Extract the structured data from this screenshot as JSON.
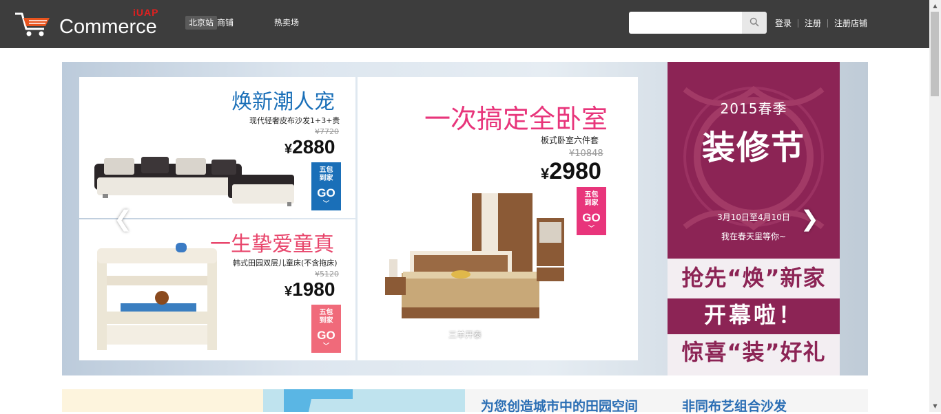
{
  "header": {
    "logo_badge": "iUAP",
    "logo_text": "Commerce",
    "city": "北京站",
    "nav": [
      "商铺",
      "热卖场"
    ],
    "search": {
      "placeholder": "",
      "value": ""
    },
    "links": [
      "登录",
      "注册",
      "注册店铺"
    ],
    "colors": {
      "bar": "#3d3d3d",
      "badge": "#e02020"
    }
  },
  "banner": {
    "prev_icon": "chevron-left-icon",
    "next_icon": "chevron-right-icon",
    "caption": "三羊开泰",
    "ads": [
      {
        "title": "焕新潮人宠",
        "subtitle": "现代轻奢皮布沙发1+3+贵",
        "old_price": "¥7720",
        "currency": "¥",
        "price": "2880",
        "tag_line1": "五包",
        "tag_line2": "到家",
        "tag_go": "GO",
        "title_color": "#1a6fb8",
        "tag_color": "#1a6fb8"
      },
      {
        "title": "一生挚爱童真",
        "subtitle": "韩式田园双层儿童床(不含拖床)",
        "old_price": "¥5120",
        "currency": "¥",
        "price": "1980",
        "tag_line1": "五包",
        "tag_line2": "到家",
        "tag_go": "GO",
        "title_color": "#e8456b",
        "tag_color": "#f06a7a"
      },
      {
        "title": "一次搞定全卧室",
        "subtitle": "板式卧室六件套",
        "old_price": "¥10848",
        "currency": "¥",
        "price": "2980",
        "tag_line1": "五包",
        "tag_line2": "到家",
        "tag_go": "GO",
        "title_color": "#e8357b",
        "tag_color": "#e8357b"
      }
    ],
    "side": {
      "year": "2015春季",
      "festival": "装修节",
      "date": "3月10日至4月10日",
      "tagline": "我在春天里等你~",
      "line1": "抢先“焕”新家",
      "line2": "开幕啦！",
      "line3": "惊喜“装”好礼",
      "color": "#8c2455"
    }
  },
  "promos": {
    "right_headline_1": "为您创造城市中的田园空间",
    "right_headline_2": "非同布艺组合沙发"
  }
}
